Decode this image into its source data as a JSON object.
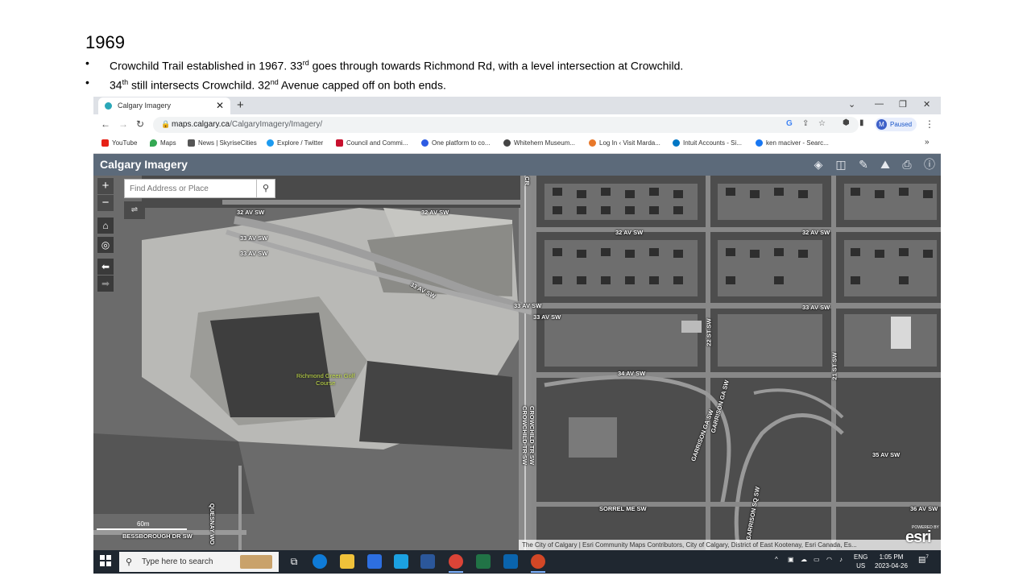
{
  "slide": {
    "title": "1969",
    "bullet1_a": "Crowchild Trail established in 1967.  33",
    "bullet1_sup": "rd",
    "bullet1_b": " goes through towards Richmond Rd, with a level intersection at Crowchild.",
    "bullet2_a": "34",
    "bullet2_sup": "th",
    "bullet2_b": " still intersects Crowchild. 32",
    "bullet2_sup2": "nd",
    "bullet2_c": " Avenue capped off on both ends.",
    "bullet_char": "•"
  },
  "browser": {
    "tab_title": "Calgary Imagery",
    "new_tab": "+",
    "url_host": "maps.calgary.ca",
    "url_path": "/CalgaryImagery/Imagery/",
    "profile_initial": "M",
    "profile_status": "Paused",
    "bookmarks": [
      {
        "label": "YouTube",
        "color": "#e62117"
      },
      {
        "label": "Maps",
        "color": "#34a853"
      },
      {
        "label": "News | SkyriseCities",
        "color": "#555555"
      },
      {
        "label": "Explore / Twitter",
        "color": "#1d9bf0"
      },
      {
        "label": "Council and Commi...",
        "color": "#c8102e"
      },
      {
        "label": "One platform to co...",
        "color": "#2d5be3"
      },
      {
        "label": "Whitehern Museum...",
        "color": "#444444"
      },
      {
        "label": "Log In ‹ Visit Marda...",
        "color": "#e8782a"
      },
      {
        "label": "Intuit Accounts - Si...",
        "color": "#0077c5"
      },
      {
        "label": "ken maciver - Searc...",
        "color": "#1877f2"
      }
    ],
    "bookmarks_more": "»"
  },
  "app": {
    "title": "Calgary Imagery",
    "search_placeholder": "Find Address or Place",
    "zoom_in": "+",
    "zoom_out": "−"
  },
  "map": {
    "road_labels": [
      "32 AV SW",
      "32 AV SW",
      "33 AV SW",
      "33 AV SW",
      "32 AV SW",
      "32 AV SW",
      "33 AV SW",
      "33 AV SW",
      "33 AV SW",
      "33 AV SW",
      "34 AV SW",
      "22 ST SW",
      "21 ST SW",
      "CROWCHILD TR SW",
      "CROWCHILD TR SW",
      "GARRISON GA SW",
      "GARRISON GA SW",
      "35 AV SW",
      "36 AV SW",
      "SORREL ME SW",
      "GARRISON SQ SW",
      "QUESNAY WO",
      "BESSBOROUGH DR SW",
      "CR"
    ],
    "poi_label_line1": "Richmond Green Golf",
    "poi_label_line2": "Course",
    "scale_label": "60m",
    "attribution": "The City of Calgary | Esri Community Maps Contributors, City of Calgary, District of East Kootenay, Esri Canada, Es...",
    "esri_powered": "POWERED BY",
    "esri_logo": "esri"
  },
  "taskbar": {
    "search_text": "Type here to search",
    "lang": "ENG",
    "region": "US",
    "time": "1:05 PM",
    "date": "2023-04-26",
    "notification_count": "7"
  }
}
